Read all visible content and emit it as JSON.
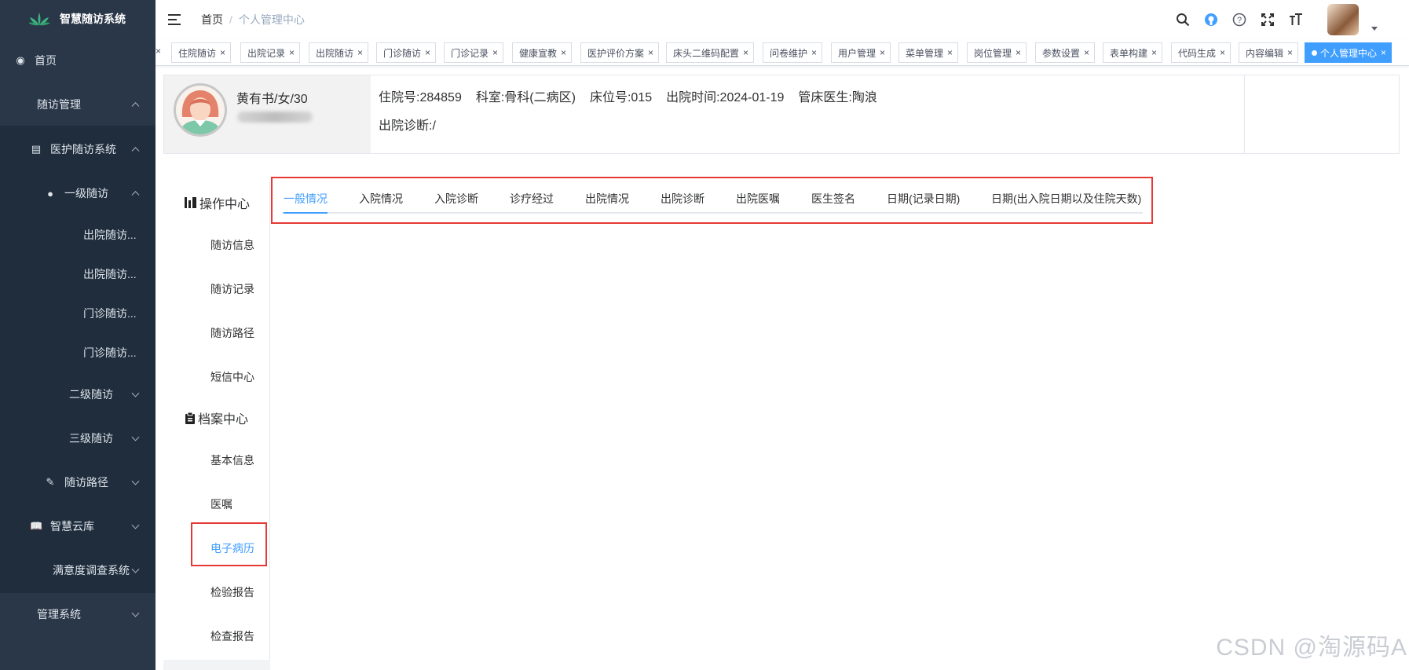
{
  "app": {
    "title": "智慧随访系统"
  },
  "sidebar": {
    "items": [
      {
        "label": "首页",
        "icon": "dashboard-icon"
      },
      {
        "label": "随访管理"
      },
      {
        "label": "医护随访系统",
        "icon": "table-icon"
      },
      {
        "label": "一级随访",
        "icon": "user-icon"
      },
      {
        "label": "出院随访..."
      },
      {
        "label": "出院随访..."
      },
      {
        "label": "门诊随访..."
      },
      {
        "label": "门诊随访..."
      },
      {
        "label": "二级随访"
      },
      {
        "label": "三级随访"
      },
      {
        "label": "随访路径",
        "icon": "edit-icon"
      },
      {
        "label": "智慧云库",
        "icon": "book-icon"
      },
      {
        "label": "满意度调查系统"
      },
      {
        "label": "管理系统"
      }
    ]
  },
  "breadcrumb": {
    "home": "首页",
    "separator": "/",
    "current": "个人管理中心"
  },
  "tags": [
    "住院随访",
    "出院记录",
    "出院随访",
    "门诊随访",
    "门诊记录",
    "健康宣教",
    "医护评价方案",
    "床头二维码配置",
    "问卷维护",
    "用户管理",
    "菜单管理",
    "岗位管理",
    "参数设置",
    "表单构建",
    "代码生成",
    "内容编辑",
    "个人管理中心"
  ],
  "tag_close": "×",
  "patient": {
    "name_line": "黄有书/女/30",
    "admission_no": "住院号:284859",
    "department": "科室:骨科(二病区)",
    "bed": "床位号:015",
    "discharge_time": "出院时间:2024-01-19",
    "doctor": "管床医生:陶浪",
    "diagnosis": "出院诊断:/"
  },
  "ops": {
    "section1": "操作中心",
    "section1_items": [
      "随访信息",
      "随访记录",
      "随访路径",
      "短信中心"
    ],
    "section2": "档案中心",
    "section2_items": [
      "基本信息",
      "医嘱",
      "电子病历",
      "检验报告",
      "检查报告"
    ]
  },
  "tabs": [
    "一般情况",
    "入院情况",
    "入院诊断",
    "诊疗经过",
    "出院情况",
    "出院诊断",
    "出院医嘱",
    "医生签名",
    "日期(记录日期)",
    "日期(出入院日期以及住院天数)"
  ],
  "watermark": "CSDN @淘源码A",
  "colors": {
    "primary": "#409eff",
    "sidebar": "#2a3748",
    "highlight": "#e53935"
  }
}
